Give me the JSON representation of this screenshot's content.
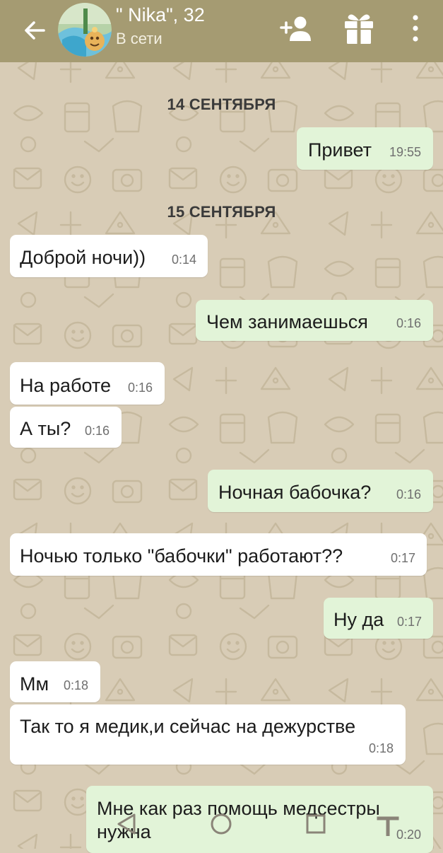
{
  "header": {
    "contact_name": "\" Nika\", 32",
    "status": "В сети",
    "icons": [
      "back-arrow-icon",
      "avatar",
      "add-user-icon",
      "gift-icon",
      "more-vertical-icon"
    ]
  },
  "colors": {
    "header_bg": "#a59b72",
    "chat_bg": "#d8ccb6",
    "incoming_bubble": "#ffffff",
    "outgoing_bubble": "#e2f4d8"
  },
  "dates": {
    "first": "14 СЕНТЯБРЯ",
    "second": "15 СЕНТЯБРЯ"
  },
  "messages": [
    {
      "direction": "out",
      "text": "Привет",
      "time": "19:55"
    },
    {
      "direction": "in",
      "text": "Доброй ночи))",
      "time": "0:14"
    },
    {
      "direction": "out",
      "text": "Чем занимаешься",
      "time": "0:16"
    },
    {
      "direction": "in",
      "text": "На работе",
      "time": "0:16"
    },
    {
      "direction": "in",
      "text": "А ты?",
      "time": "0:16"
    },
    {
      "direction": "out",
      "text": "Ночная бабочка?",
      "time": "0:16"
    },
    {
      "direction": "in",
      "text": "Ночью только \"бабочки\" работают??",
      "time": "0:17"
    },
    {
      "direction": "out",
      "text": "Ну да",
      "time": "0:17"
    },
    {
      "direction": "in",
      "text": "Мм",
      "time": "0:18"
    },
    {
      "direction": "in",
      "text": "Так то я медик,и сейчас на дежурстве",
      "time": "0:18"
    },
    {
      "direction": "out",
      "text_lines": [
        "Мне как раз помощь медсестры",
        "нужна"
      ],
      "time": "0:20"
    }
  ],
  "navbar": {
    "icons": [
      "back-triangle-icon",
      "home-circle-icon",
      "recents-square-icon",
      "accessibility-icon"
    ]
  }
}
